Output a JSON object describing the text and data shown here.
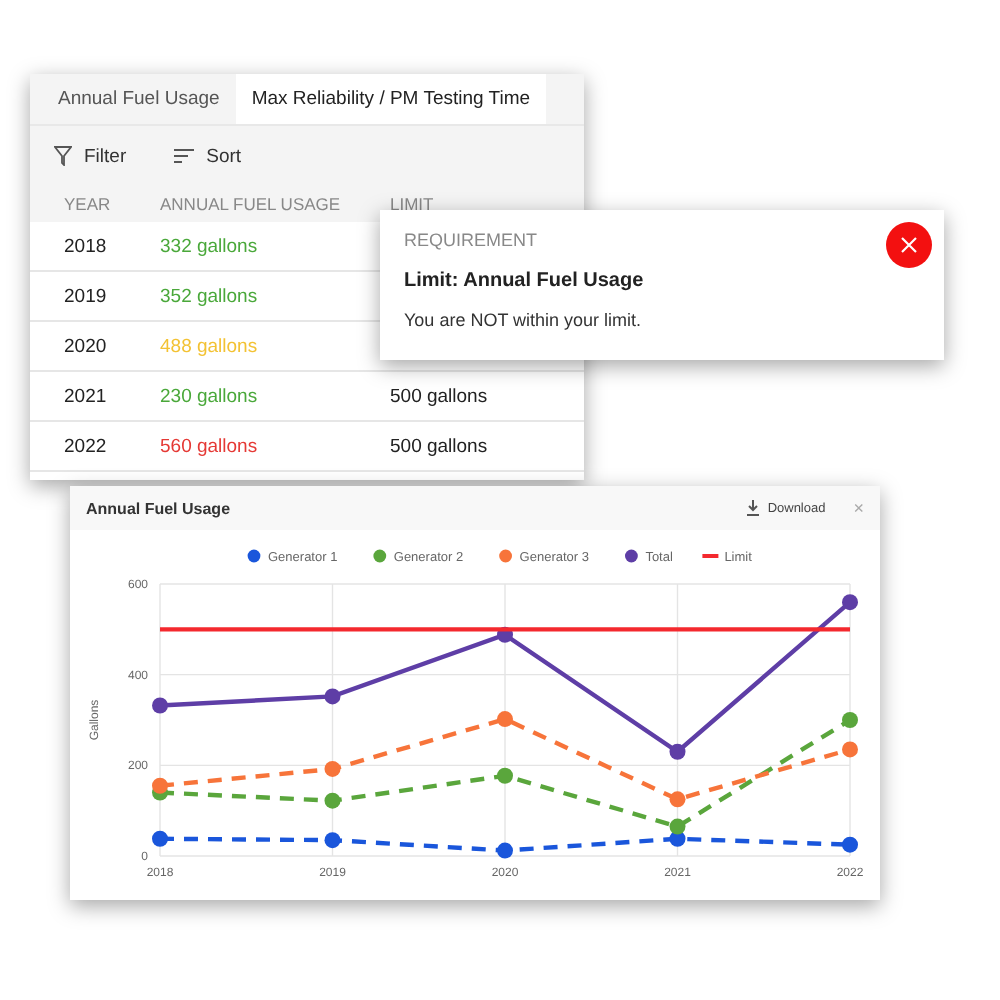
{
  "table_panel": {
    "tabs": [
      {
        "label": "Annual Fuel Usage",
        "selected": false
      },
      {
        "label": "Max Reliability / PM Testing Time",
        "selected": true
      }
    ],
    "toolbar": {
      "filter": "Filter",
      "sort": "Sort"
    },
    "columns": [
      "YEAR",
      "ANNUAL FUEL USAGE",
      "LIMIT"
    ],
    "rows": [
      {
        "year": "2018",
        "usage": "332 gallons",
        "color": "#4aa83a"
      },
      {
        "year": "2019",
        "usage": "352 gallons",
        "color": "#4aa83a"
      },
      {
        "year": "2020",
        "usage": "488 gallons",
        "color": "#f3c233"
      },
      {
        "year": "2021",
        "usage": "230 gallons",
        "color": "#4aa83a",
        "limit": "500 gallons"
      },
      {
        "year": "2022",
        "usage": "560 gallons",
        "color": "#e53935",
        "limit": "500 gallons"
      }
    ]
  },
  "requirement_popup": {
    "heading": "REQUIREMENT",
    "title": "Limit: Annual Fuel Usage",
    "message": "You are NOT within your limit."
  },
  "chart_panel": {
    "title": "Annual Fuel Usage",
    "download": "Download",
    "close": "×",
    "chart_data": {
      "type": "line",
      "grid": true,
      "legend": true,
      "ylabel": "Gallons",
      "categories": [
        "2018",
        "2019",
        "2020",
        "2021",
        "2022"
      ],
      "ylim": [
        0,
        600
      ],
      "yticks": [
        0,
        200,
        400,
        600
      ],
      "series": [
        {
          "name": "Generator 1",
          "color": "#1a56db",
          "line_style": "dashed",
          "marker": "circle",
          "values": [
            38,
            35,
            12,
            38,
            25
          ]
        },
        {
          "name": "Generator 2",
          "color": "#5aa63c",
          "line_style": "dashed",
          "marker": "circle",
          "values": [
            140,
            122,
            177,
            65,
            300
          ]
        },
        {
          "name": "Generator 3",
          "color": "#f7743a",
          "line_style": "dashed",
          "marker": "circle",
          "values": [
            155,
            192,
            302,
            125,
            235
          ]
        },
        {
          "name": "Total",
          "color": "#5e3ea6",
          "line_style": "solid",
          "marker": "circle",
          "values": [
            332,
            352,
            488,
            230,
            560
          ]
        },
        {
          "name": "Limit",
          "color": "#f4292e",
          "line_style": "solid",
          "marker": "none",
          "values": [
            500,
            500,
            500,
            500,
            500
          ]
        }
      ]
    }
  }
}
